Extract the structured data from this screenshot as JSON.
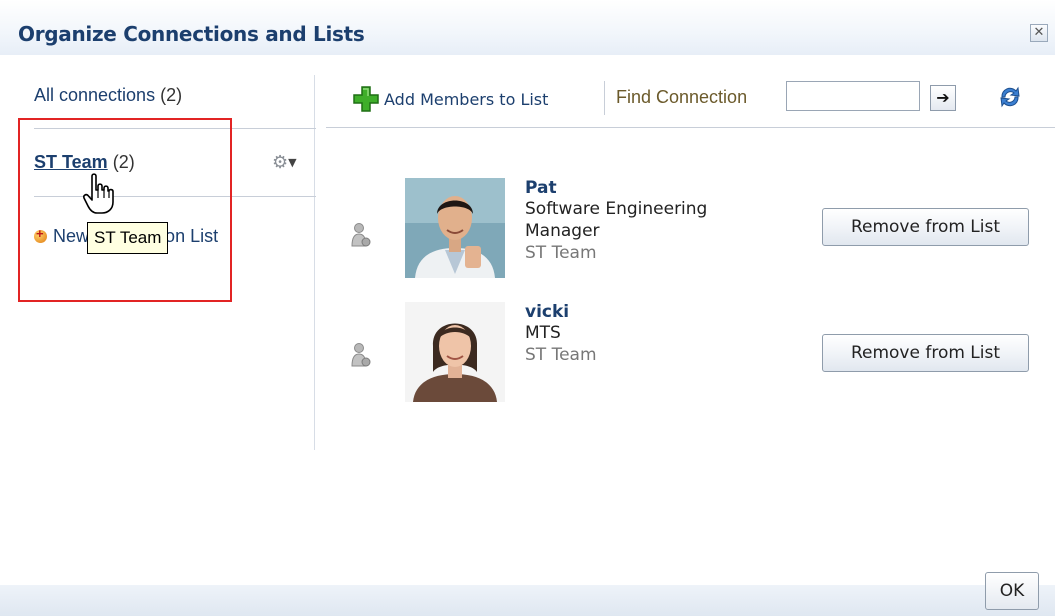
{
  "dialog": {
    "title": "Organize Connections and Lists",
    "close_icon": "close-icon"
  },
  "left": {
    "all_connections": {
      "label": "All connections",
      "count": "(2)"
    },
    "lists": [
      {
        "label": "ST Team",
        "count": "(2)",
        "menu_icon": "gear-icon"
      }
    ],
    "new_list_label": "New Connection List",
    "tooltip": "ST Team"
  },
  "toolbar": {
    "add_members_label": "Add Members to List",
    "find_label": "Find Connection",
    "find_value": "",
    "go_icon": "arrow-right-icon",
    "refresh_icon": "refresh-icon"
  },
  "members": [
    {
      "name": "Pat",
      "title_line1": "Software Engineering",
      "title_line2": "Manager",
      "list": "ST Team",
      "action": "Remove from List"
    },
    {
      "name": "vicki",
      "title_line1": "MTS",
      "title_line2": "",
      "list": "ST Team",
      "action": "Remove from List"
    }
  ],
  "footer": {
    "ok_label": "OK"
  },
  "colors": {
    "link": "#1c3f6e",
    "highlight_box": "#e22424",
    "tooltip_bg": "#ffffe1"
  }
}
